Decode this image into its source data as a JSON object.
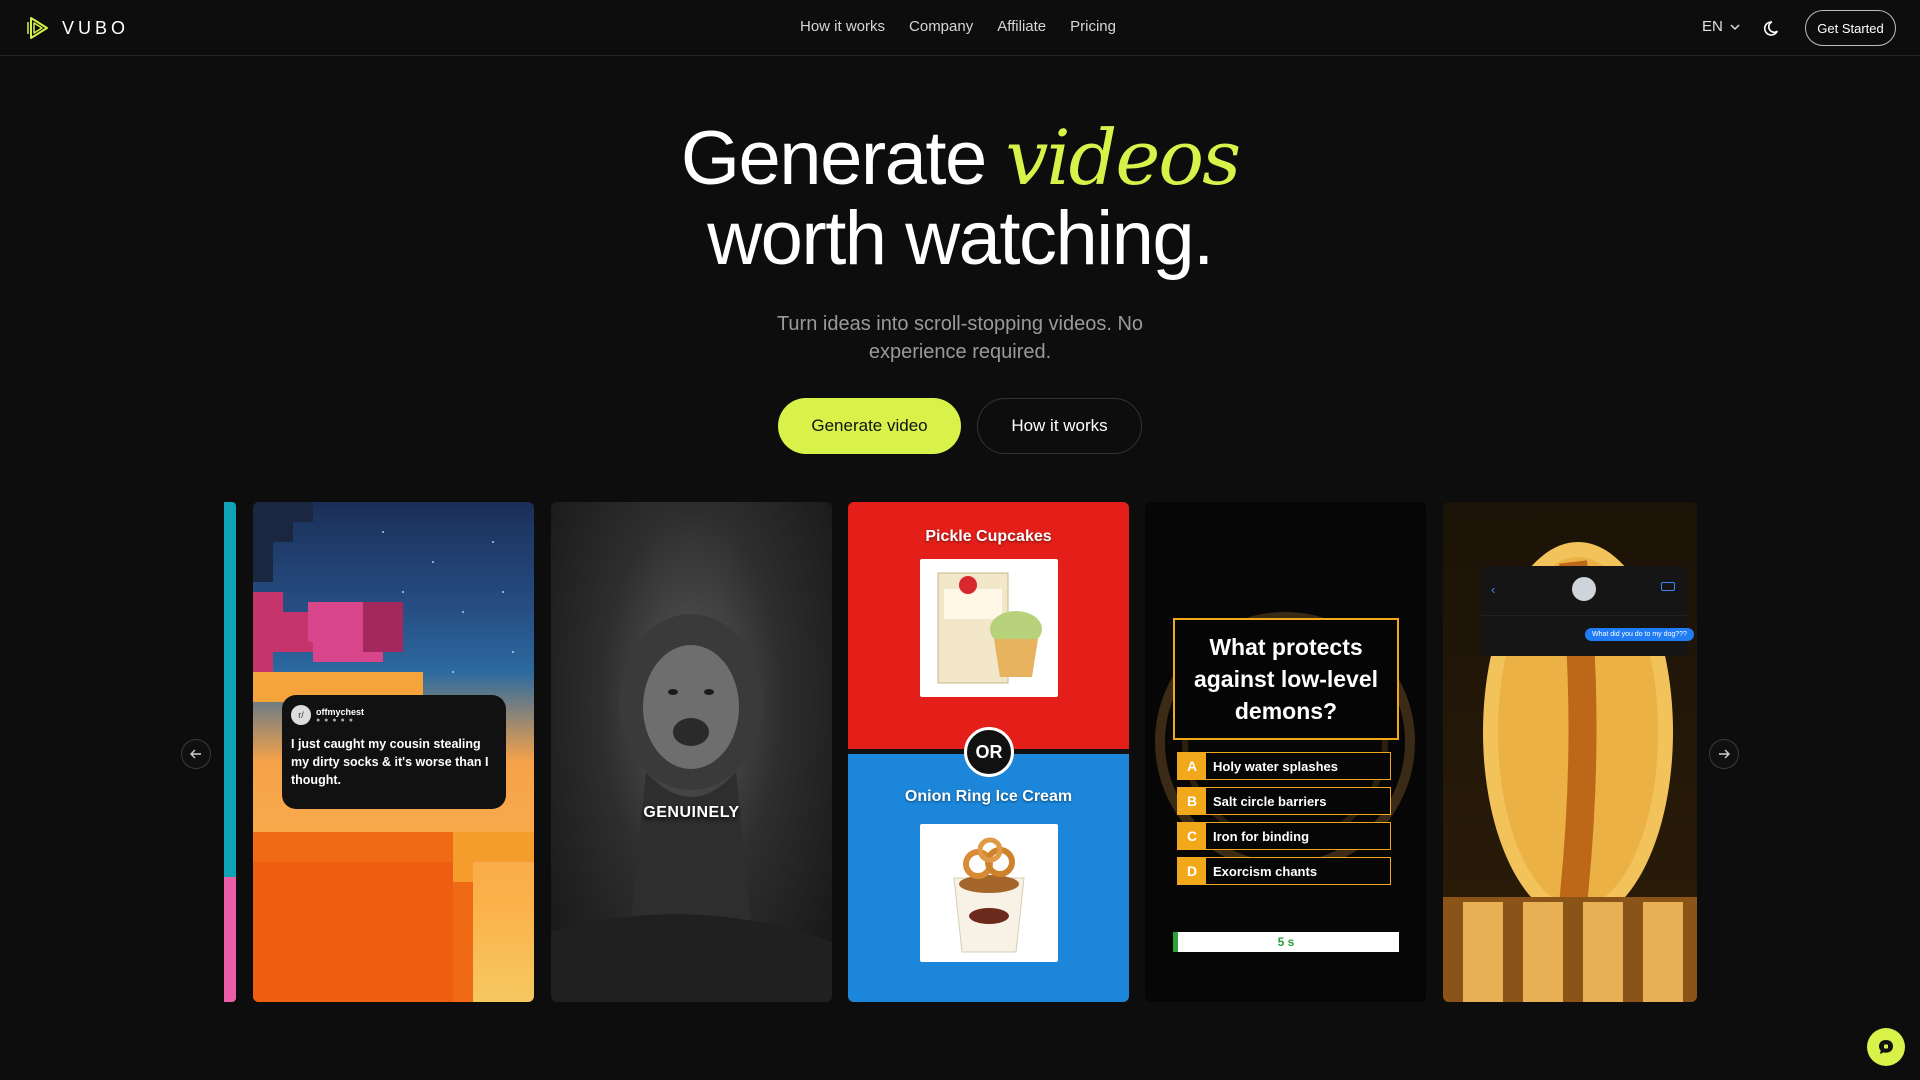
{
  "nav": {
    "logo_text": "VUBO",
    "links": [
      "How it works",
      "Company",
      "Affiliate",
      "Pricing"
    ],
    "language": "EN",
    "cta": "Get Started"
  },
  "hero": {
    "title_before": "Generate",
    "title_accent": "videos",
    "title_line2": "worth watching.",
    "subtitle": "Turn ideas into scroll-stopping videos. No experience required.",
    "primary_button": "Generate video",
    "secondary_button": "How it works"
  },
  "colors": {
    "accent": "#d9f24a",
    "background": "#0d0d0d"
  },
  "carousel": {
    "card1": {
      "username": "offmychest",
      "text": "I just caught my cousin stealing my dirty socks & it's worse than I thought."
    },
    "card2": {
      "caption": "GENUINELY"
    },
    "card3": {
      "option_a": "Pickle Cupcakes",
      "option_b": "Onion Ring Ice Cream",
      "divider_label": "OR"
    },
    "card4": {
      "question": "What protects against low-level demons?",
      "options": [
        {
          "letter": "A",
          "text": "Holy water splashes"
        },
        {
          "letter": "B",
          "text": "Salt circle barriers"
        },
        {
          "letter": "C",
          "text": "Iron for binding"
        },
        {
          "letter": "D",
          "text": "Exorcism chants"
        }
      ],
      "timer": "5 s",
      "timer_progress": 0.02
    },
    "card5": {
      "message": "What did you do to my dog???"
    }
  }
}
